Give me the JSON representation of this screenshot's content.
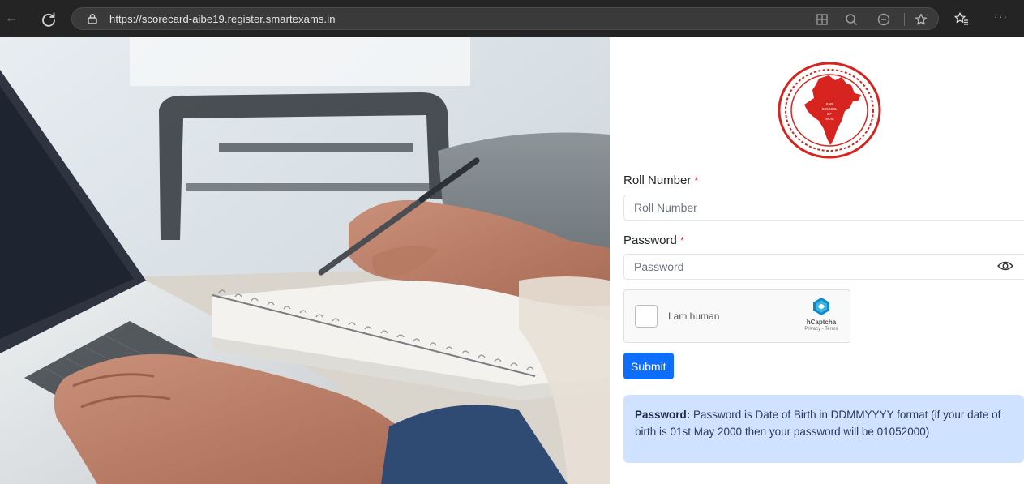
{
  "browser": {
    "url_host": "https://scorecard-aibe19.register.smartexams.in",
    "back_icon": "back-arrow-icon",
    "reload_icon": "reload-icon",
    "lock_icon": "site-info-lock-icon",
    "toolbar_icons": [
      "reader-view-icon",
      "zoom-icon",
      "minus-circle-icon",
      "star-icon",
      "favorites-icon",
      "more-icon"
    ],
    "more_label": "···"
  },
  "hero": {
    "description_icon": "laptop-notebook-photo"
  },
  "logo": {
    "icon": "bar-council-of-india-emblem"
  },
  "form": {
    "roll_label": "Roll Number",
    "roll_required": "*",
    "roll_placeholder": "Roll Number",
    "password_label": "Password",
    "password_required": "*",
    "password_placeholder": "Password",
    "captcha_text": "I am human",
    "captcha_brand": "hCaptcha",
    "captcha_links": "Privacy - Terms",
    "submit_label": "Submit"
  },
  "info": {
    "heading": "Password:",
    "body": " Password is Date of Birth in DDMMYYYY format (if your date of birth is 01st May 2000 then your password will be 01052000)"
  },
  "colors": {
    "primary": "#0d6efd",
    "info_bg": "#cfe2ff",
    "required": "#dc3545",
    "emblem_red": "#d8241f"
  }
}
